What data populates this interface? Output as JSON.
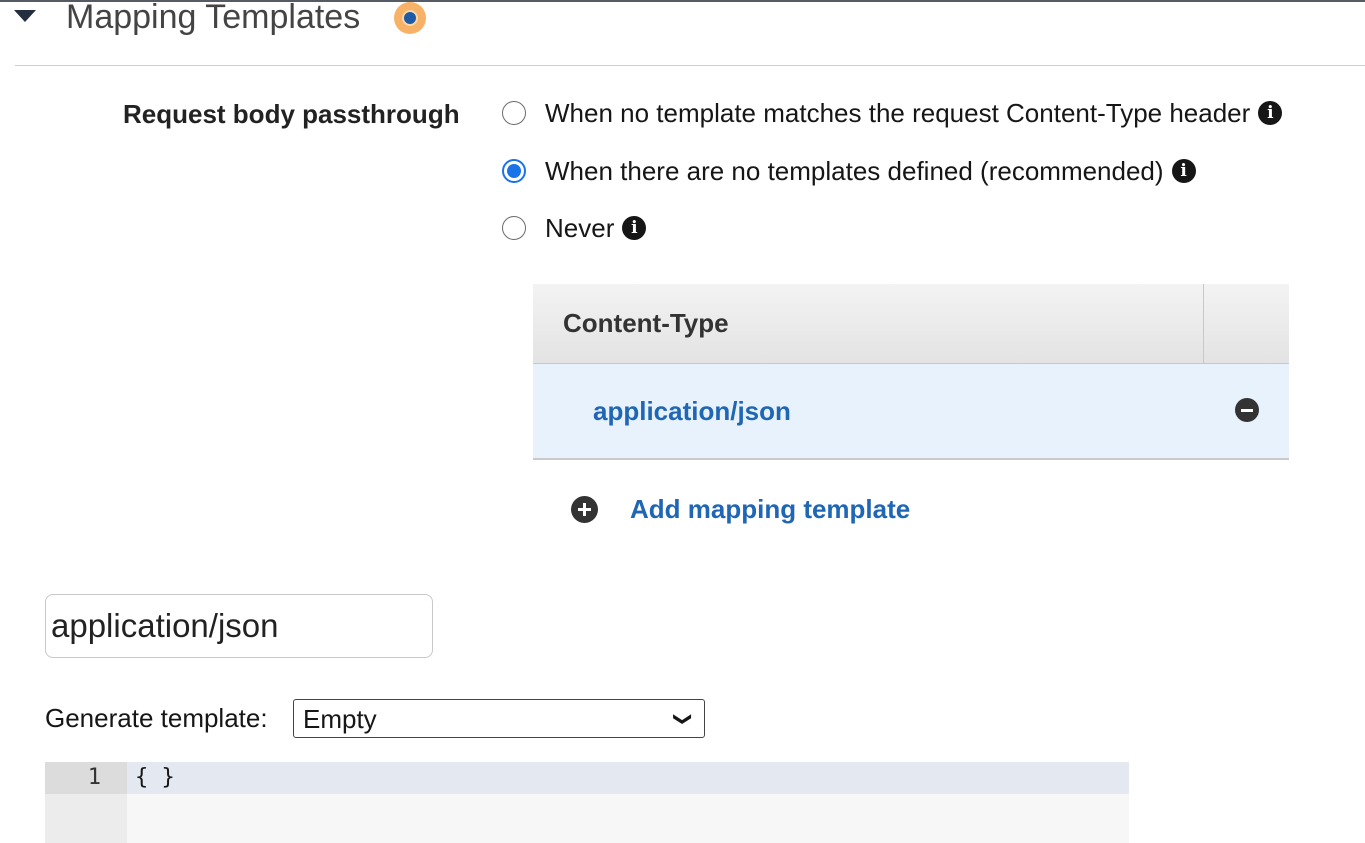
{
  "section": {
    "title": "Mapping Templates"
  },
  "passthrough": {
    "label": "Request body passthrough",
    "options": [
      {
        "label": "When no template matches the request Content-Type header",
        "selected": false
      },
      {
        "label": "When there are no templates defined (recommended)",
        "selected": true
      },
      {
        "label": "Never",
        "selected": false
      }
    ]
  },
  "content_types": {
    "header": "Content-Type",
    "rows": [
      "application/json"
    ],
    "add_label": "Add mapping template"
  },
  "editor_panel": {
    "content_type_value": "application/json",
    "generate_label": "Generate template:",
    "generate_value": "Empty",
    "code_lines": [
      {
        "number": "1",
        "text": "{ }"
      }
    ]
  },
  "icons": {
    "info": "info-icon",
    "remove": "minus-circle-icon",
    "add": "plus-circle-icon",
    "caret": "caret-down-icon"
  },
  "colors": {
    "link": "#1f66b4",
    "radio_selected": "#1a73e8",
    "row_highlight": "#e8f2fc",
    "status_dot": "#f7b267"
  }
}
